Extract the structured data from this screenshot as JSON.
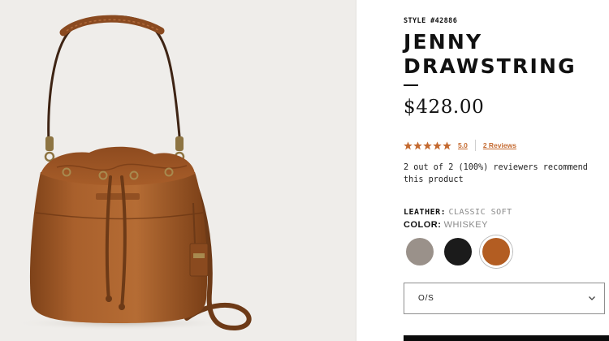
{
  "product": {
    "style_number": "STYLE #42886",
    "title": "JENNY DRAWSTRING",
    "price": "$428.00"
  },
  "rating": {
    "stars": 5,
    "value": "5.0",
    "reviews_link": "2 Reviews",
    "star_color": "#c4692f"
  },
  "recommend_text": "2 out of 2 (100%) reviewers recommend this product",
  "options": {
    "leather_label": "LEATHER:",
    "leather_value": "CLASSIC SOFT",
    "color_label": "COLOR:",
    "color_value": "WHISKEY",
    "swatches": [
      {
        "name": "grey",
        "color": "#9a918a",
        "selected": false
      },
      {
        "name": "black",
        "color": "#1b1b1b",
        "selected": false
      },
      {
        "name": "whiskey",
        "color": "#b35d22",
        "selected": true
      }
    ]
  },
  "size_select": {
    "value": "O/S",
    "icon": "chevron-down-icon"
  },
  "image": {
    "alt_subject": "bucket-bag-product-image",
    "leather_color": "#a9602c",
    "background": "#efedea"
  }
}
